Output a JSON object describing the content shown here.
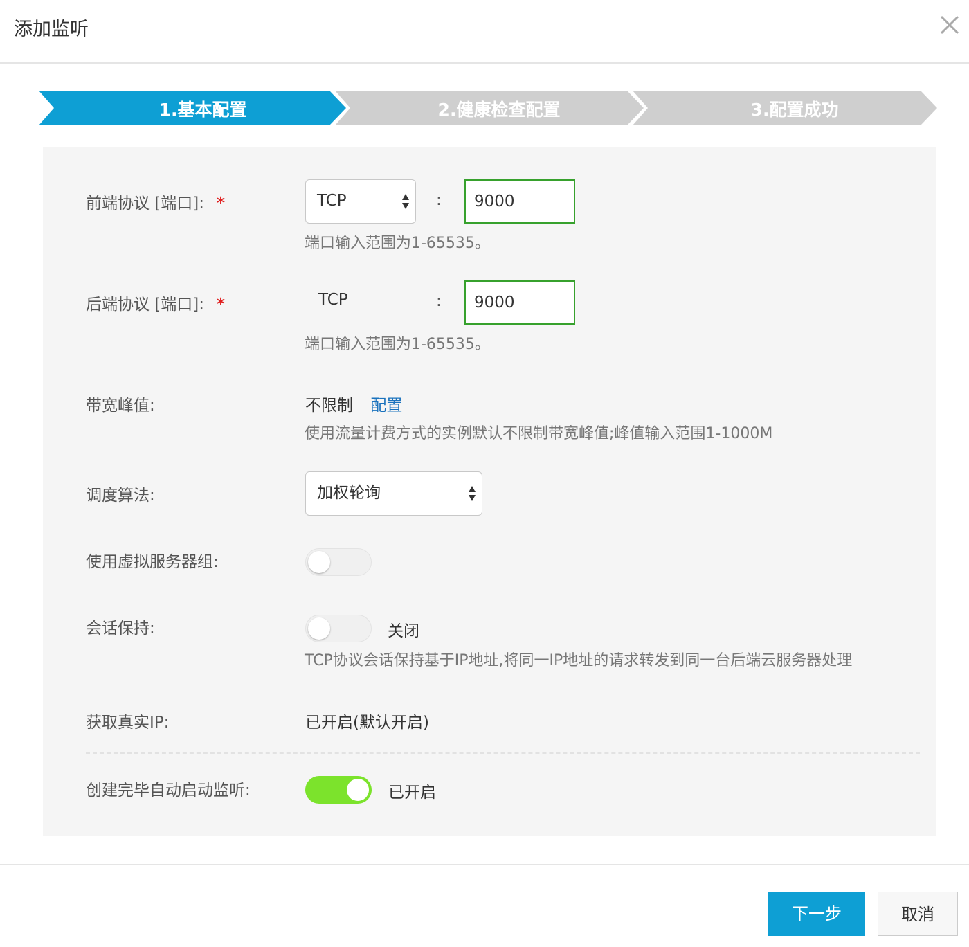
{
  "dialog": {
    "title": "添加监听"
  },
  "steps": [
    {
      "label": "1.基本配置",
      "active": true
    },
    {
      "label": "2.健康检查配置",
      "active": false
    },
    {
      "label": "3.配置成功",
      "active": false
    }
  ],
  "colors": {
    "active_step": "#0e9fd4",
    "inactive_step": "#cfcfcf",
    "toggle_on": "#7ce32c",
    "port_border": "#37a12d",
    "link": "#1a72bd",
    "required": "#e02020"
  },
  "form": {
    "frontend": {
      "label": "前端协议 [端口]:",
      "required_mark": "*",
      "protocol": "TCP",
      "colon": ":",
      "port": "9000",
      "hint": "端口输入范围为1-65535。"
    },
    "backend": {
      "label": "后端协议 [端口]:",
      "required_mark": "*",
      "protocol": "TCP",
      "colon": ":",
      "port": "9000",
      "hint": "端口输入范围为1-65535。"
    },
    "bandwidth": {
      "label": "带宽峰值:",
      "value": "不限制",
      "link": "配置",
      "hint": "使用流量计费方式的实例默认不限制带宽峰值;峰值输入范围1-1000M"
    },
    "algorithm": {
      "label": "调度算法:",
      "value": "加权轮询"
    },
    "vserver_group": {
      "label": "使用虚拟服务器组:",
      "enabled": false
    },
    "session": {
      "label": "会话保持:",
      "enabled": false,
      "status": "关闭",
      "hint": "TCP协议会话保持基于IP地址,将同一IP地址的请求转发到同一台后端云服务器处理"
    },
    "real_ip": {
      "label": "获取真实IP:",
      "value": "已开启(默认开启)"
    },
    "auto_start": {
      "label": "创建完毕自动启动监听:",
      "enabled": true,
      "status": "已开启"
    }
  },
  "footer": {
    "next": "下一步",
    "cancel": "取消"
  }
}
